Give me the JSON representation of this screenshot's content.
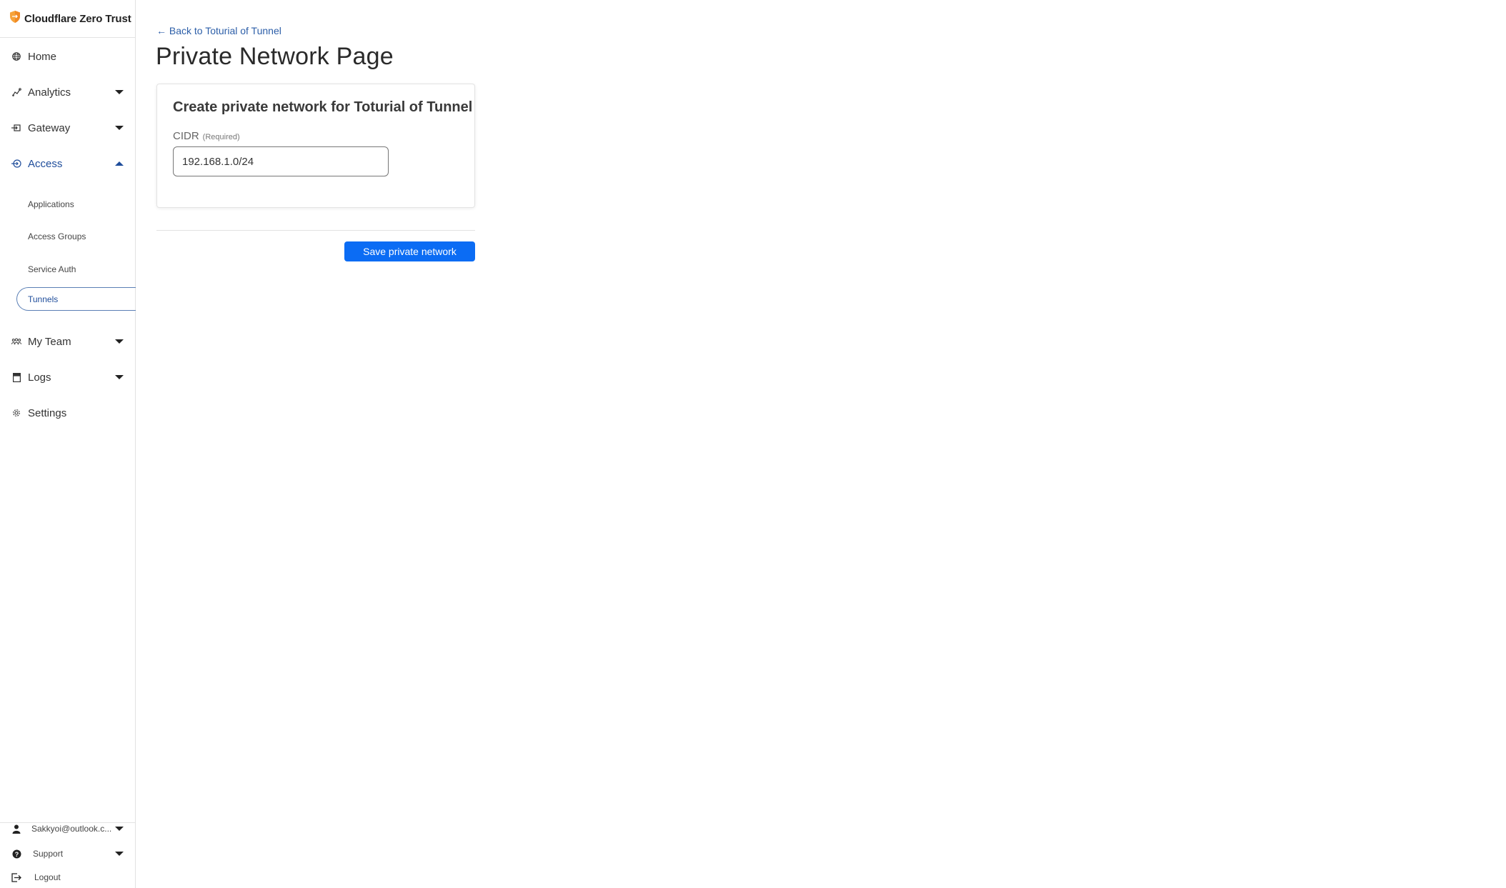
{
  "brand": {
    "name": "Cloudflare Zero Trust",
    "logo_color": "#f6a33a"
  },
  "sidebar": {
    "items": [
      {
        "label": "Home",
        "icon": "globe-icon",
        "expandable": false
      },
      {
        "label": "Analytics",
        "icon": "analytics-icon",
        "expandable": true,
        "expanded": false
      },
      {
        "label": "Gateway",
        "icon": "gateway-icon",
        "expandable": true,
        "expanded": false
      },
      {
        "label": "Access",
        "icon": "access-icon",
        "expandable": true,
        "expanded": true,
        "active": true,
        "children": [
          {
            "label": "Applications"
          },
          {
            "label": "Access Groups"
          },
          {
            "label": "Service Auth"
          },
          {
            "label": "Tunnels",
            "selected": true
          }
        ]
      },
      {
        "label": "My Team",
        "icon": "team-icon",
        "expandable": true,
        "expanded": false
      },
      {
        "label": "Logs",
        "icon": "logs-icon",
        "expandable": true,
        "expanded": false
      },
      {
        "label": "Settings",
        "icon": "gear-icon",
        "expandable": false
      }
    ],
    "bottom": {
      "account": {
        "label": "Sakkyoi@outlook.c...",
        "icon": "user-icon"
      },
      "support": {
        "label": "Support",
        "icon": "help-icon"
      },
      "logout": {
        "label": "Logout",
        "icon": "logout-icon"
      }
    },
    "active_color": "#1f4d9b"
  },
  "main": {
    "back_link": "← Back to Toturial of Tunnel",
    "title": "Private Network Page",
    "card": {
      "title": "Create private network for Toturial of Tunnel",
      "cidr_label": "CIDR",
      "cidr_required": "(Required)",
      "cidr_value": "192.168.1.0/24"
    },
    "save_button": "Save private network",
    "primary_color": "#0b6cf4"
  }
}
